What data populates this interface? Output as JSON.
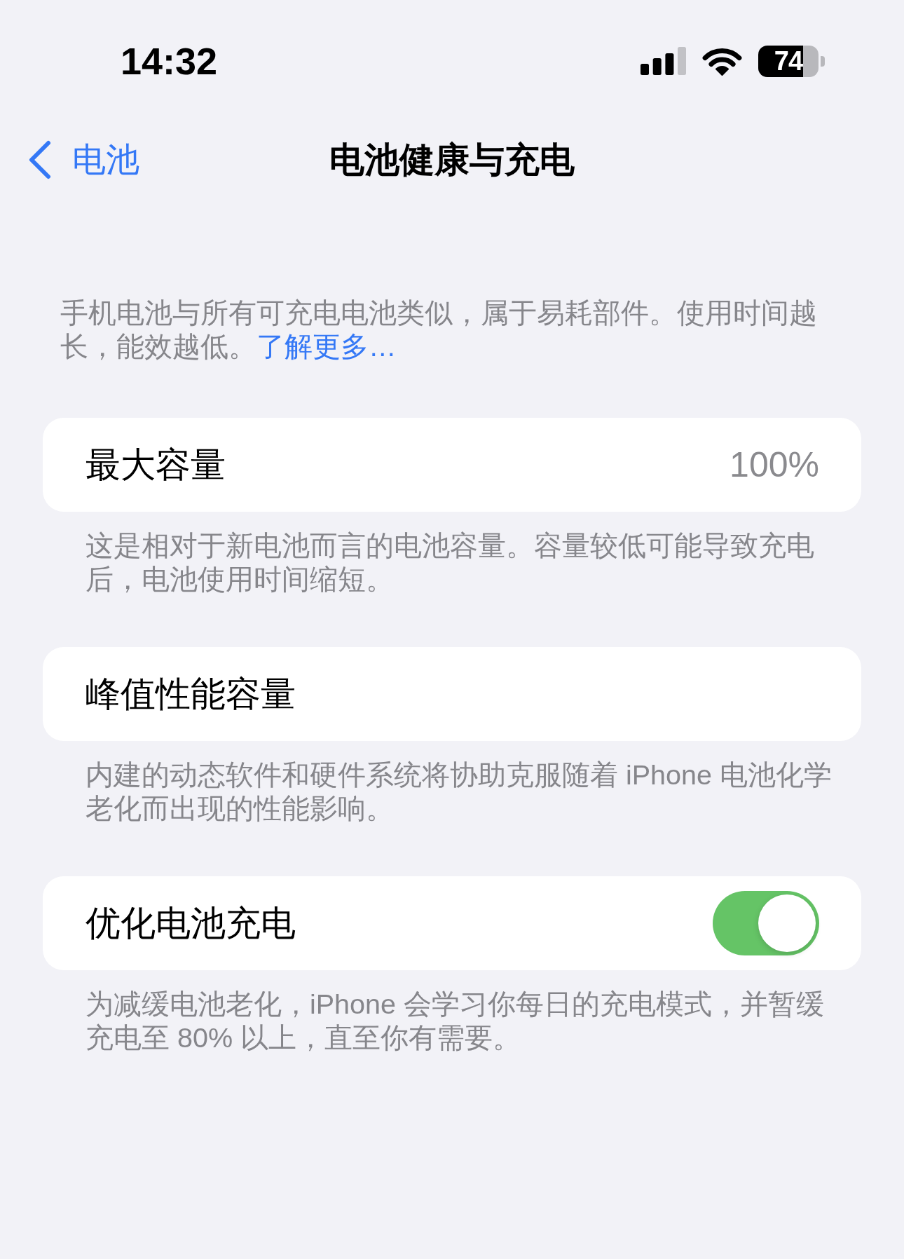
{
  "status_bar": {
    "time": "14:32",
    "battery": "74"
  },
  "nav": {
    "back": "电池",
    "title": "电池健康与充电"
  },
  "intro": {
    "text": "手机电池与所有可充电电池类似，属于易耗部件。使用时间越长，能效越低。",
    "link": "了解更多…"
  },
  "sections": [
    {
      "kind": "value",
      "label": "最大容量",
      "value": "100%",
      "footer": "这是相对于新电池而言的电池容量。容量较低可能导致充电后，电池使用时间缩短。"
    },
    {
      "kind": "plain",
      "label": "峰值性能容量",
      "footer": "内建的动态软件和硬件系统将协助克服随着 iPhone 电池化学老化而出现的性能影响。"
    },
    {
      "kind": "toggle",
      "label": "优化电池充电",
      "on": true,
      "footer": "为减缓电池老化，iPhone 会学习你每日的充电模式，并暂缓充电至 80% 以上，直至你有需要。"
    }
  ]
}
